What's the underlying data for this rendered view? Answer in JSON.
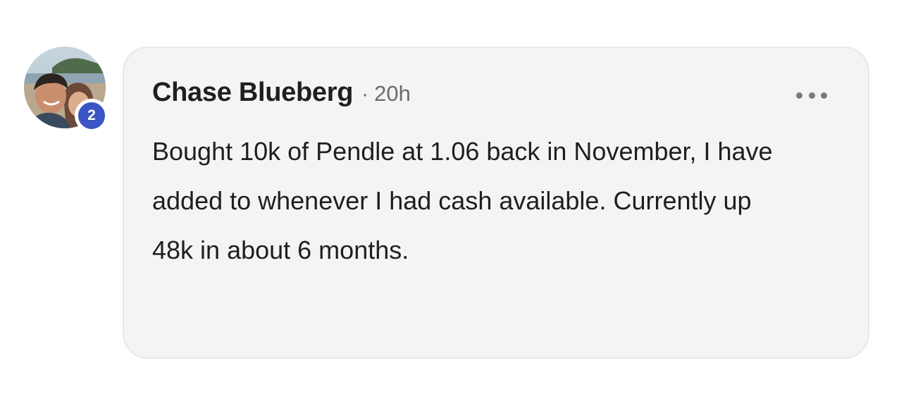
{
  "comment": {
    "author": "Chase Blueberg",
    "separator": "·",
    "timestamp": "20h",
    "badge_count": "2",
    "text": "Bought 10k of Pendle at 1.06 back in November, I have added to whenever I had cash available. Currently up 48k in about 6 months.",
    "more_icon": "more-horizontal-icon"
  },
  "colors": {
    "bubble_bg": "#f5f4f3",
    "badge_bg": "#3b55c4",
    "muted_text": "#6b6b6b"
  }
}
